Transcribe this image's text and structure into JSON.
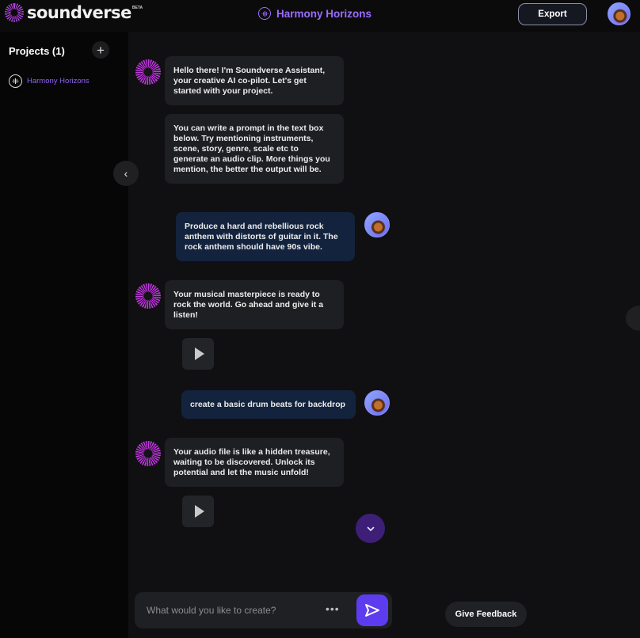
{
  "brand": {
    "name": "soundverse",
    "badge": "BETA"
  },
  "header": {
    "project_title": "Harmony Horizons",
    "export_label": "Export"
  },
  "sidebar": {
    "projects_heading": "Projects (1)",
    "add_symbol": "+",
    "items": [
      {
        "label": "Harmony Horizons"
      }
    ],
    "collapse_symbol": "‹"
  },
  "chat": {
    "messages": [
      {
        "role": "assistant",
        "text": "Hello there! I'm Soundverse Assistant, your creative AI co-pilot. Let's get started with your project."
      },
      {
        "role": "assistant",
        "text": "You can write a prompt in the text box below. Try mentioning instruments, scene, story, genre, scale etc to generate an audio clip. More things you mention, the better the output will be."
      },
      {
        "role": "user",
        "text": "Produce a hard and rebellious rock anthem with distorts of guitar in it. The rock anthem should have 90s vibe."
      },
      {
        "role": "assistant",
        "text": "Your musical masterpiece is ready to rock the world. Go ahead and give it a listen!"
      },
      {
        "role": "user",
        "text": "create a basic drum beats for backdrop"
      },
      {
        "role": "assistant",
        "text": "Your audio file is like a hidden treasure, waiting to be discovered. Unlock its potential and let the music unfold!"
      }
    ]
  },
  "composer": {
    "placeholder": "What would you like to create?",
    "more_symbol": "•••"
  },
  "feedback_label": "Give Feedback",
  "colors": {
    "accent": "#5d3cf0",
    "project_purple": "#9b6cff",
    "user_bubble": "#13233d"
  }
}
